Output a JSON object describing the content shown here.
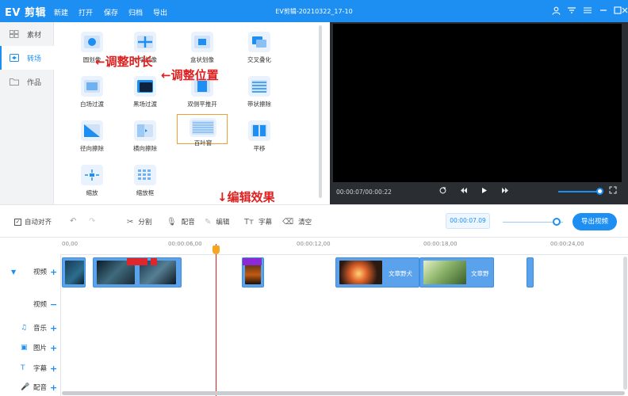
{
  "app": {
    "logo": "EV 剪辑",
    "window_title": "EV剪辑-20210322_17-10",
    "menu": [
      "新建",
      "打开",
      "保存",
      "归档",
      "导出"
    ],
    "window_icons": [
      "user-icon",
      "wifi-icon",
      "menu-icon",
      "minimize-icon",
      "maximize-icon",
      "close-icon"
    ]
  },
  "sidebar": {
    "items": [
      {
        "label": "素材",
        "icon": "grid-icon",
        "active": false
      },
      {
        "label": "转场",
        "icon": "transition-icon",
        "active": true
      },
      {
        "label": "作品",
        "icon": "folder-icon",
        "active": false
      }
    ]
  },
  "effects": {
    "items": [
      {
        "label": "圆划像"
      },
      {
        "label": "十字划像"
      },
      {
        "label": "盒状划像"
      },
      {
        "label": "交叉叠化"
      },
      {
        "label": "白场过渡"
      },
      {
        "label": "黑场过渡"
      },
      {
        "label": "双侧平推开"
      },
      {
        "label": "带状擦除"
      },
      {
        "label": "径向擦除"
      },
      {
        "label": "横向擦除"
      },
      {
        "label": "百叶窗",
        "selected": true
      },
      {
        "label": "平移"
      },
      {
        "label": "缩放"
      },
      {
        "label": "缩放框"
      }
    ]
  },
  "annotations": {
    "duration": "←调整时长",
    "position": "←调整位置",
    "effect": "↓编辑效果"
  },
  "preview": {
    "time": "00:00:07/00:00:22",
    "controls": [
      "loop-icon",
      "rewind-icon",
      "play-icon",
      "forward-icon"
    ]
  },
  "toolbar": {
    "auto_align": "自动对齐",
    "split": "分割",
    "dub": "配音",
    "edit": "编辑",
    "subtitle": "字幕",
    "clear": "清空",
    "timecode": "00:00:07.09",
    "export": "导出视频"
  },
  "timeline": {
    "ticks": [
      "00,00",
      "00:00:06,00",
      "00:00:12,00",
      "00:00:18,00",
      "00:00:24,00"
    ],
    "tracks": [
      {
        "name": "视频",
        "icon": "film-icon",
        "action": "+",
        "expanded": true
      },
      {
        "name": "视频",
        "icon": "",
        "action": "−"
      },
      {
        "name": "音乐",
        "icon": "music-icon",
        "action": "+"
      },
      {
        "name": "图片",
        "icon": "image-icon",
        "action": "+"
      },
      {
        "name": "字幕",
        "icon": "text-icon",
        "action": "+"
      },
      {
        "name": "配音",
        "icon": "mic-icon",
        "action": "+"
      }
    ],
    "clips": [
      {
        "text": ""
      },
      {
        "text": ""
      },
      {
        "text": ""
      },
      {
        "text": "文章野犬"
      },
      {
        "text": "文章野"
      },
      {
        "text": ""
      }
    ]
  },
  "colors": {
    "accent": "#1e8ff2",
    "annotation": "#e01f1f",
    "transition_mark": "#e1252d",
    "playhead_knob": "#f5a623"
  }
}
